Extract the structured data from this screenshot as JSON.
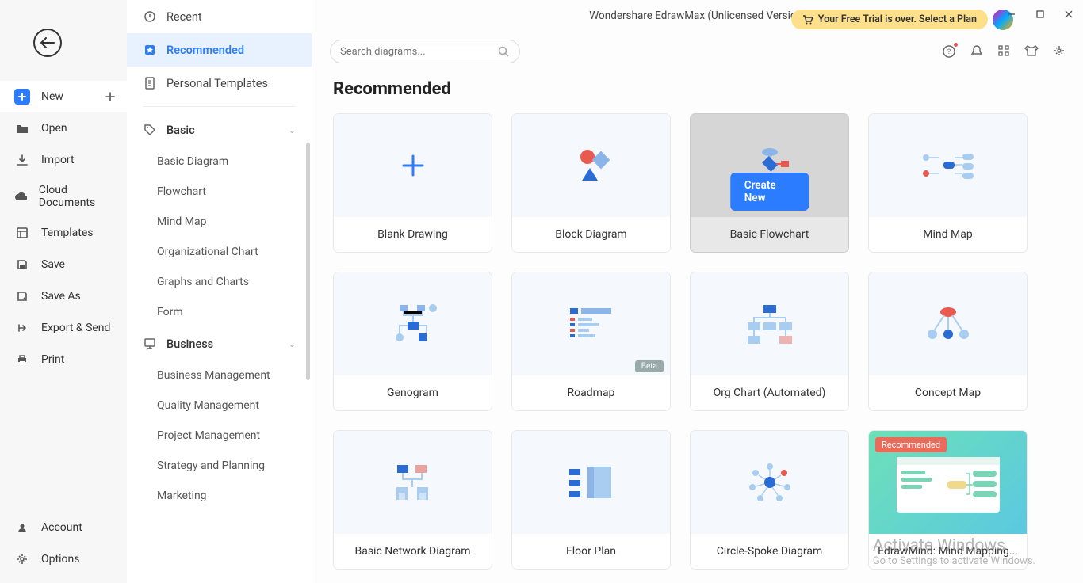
{
  "app_title": "Wondershare EdrawMax (Unlicensed Version)",
  "trial_banner": "Your Free Trial is over. Select a Plan",
  "search_placeholder": "Search diagrams...",
  "section_title": "Recommended",
  "primary_nav": {
    "new": "New",
    "open": "Open",
    "import": "Import",
    "cloud": "Cloud Documents",
    "templates": "Templates",
    "save": "Save",
    "save_as": "Save As",
    "export": "Export & Send",
    "print": "Print",
    "account": "Account",
    "options": "Options"
  },
  "secondary_nav": {
    "recent": "Recent",
    "recommended": "Recommended",
    "personal": "Personal Templates",
    "basic": "Basic",
    "basic_items": [
      "Basic Diagram",
      "Flowchart",
      "Mind Map",
      "Organizational Chart",
      "Graphs and Charts",
      "Form"
    ],
    "business": "Business",
    "business_items": [
      "Business Management",
      "Quality Management",
      "Project Management",
      "Strategy and Planning",
      "Marketing"
    ]
  },
  "cards": [
    {
      "label": "Blank Drawing"
    },
    {
      "label": "Block Diagram"
    },
    {
      "label": "Basic Flowchart",
      "hovered": true,
      "create": "Create New"
    },
    {
      "label": "Mind Map"
    },
    {
      "label": "Genogram"
    },
    {
      "label": "Roadmap",
      "badge": "Beta"
    },
    {
      "label": "Org Chart (Automated)"
    },
    {
      "label": "Concept Map"
    },
    {
      "label": "Basic Network Diagram"
    },
    {
      "label": "Floor Plan"
    },
    {
      "label": "Circle-Spoke Diagram"
    },
    {
      "label": "EdrawMind: Mind Mapping...",
      "promo": true,
      "tag": "Recommended"
    }
  ],
  "watermark": {
    "line1": "Activate Windows",
    "line2": "Go to Settings to activate Windows."
  }
}
